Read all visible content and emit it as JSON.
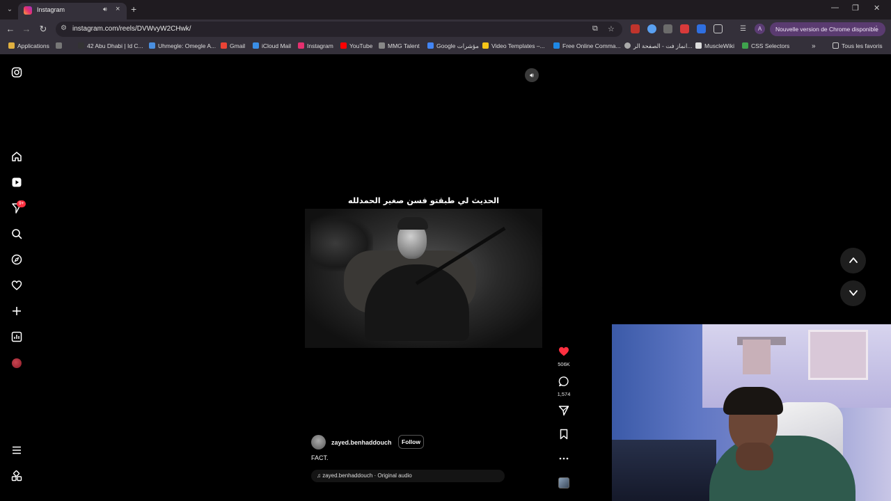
{
  "browser": {
    "tab_title": "Instagram",
    "url": "instagram.com/reels/DVWvyW2CHwk/",
    "update_label": "Nouvelle version de Chrome disponible",
    "avatar_letter": "A",
    "win_min": "—",
    "win_restore": "❐",
    "win_close": "✕",
    "bookmarks": [
      {
        "label": "Applications",
        "color": "#e0b040"
      },
      {
        "label": "42 Abu Dhabi | Id C...",
        "color": "#333333"
      },
      {
        "label": "Uhmegle: Omegle A...",
        "color": "#4a8fe0"
      },
      {
        "label": "Gmail",
        "color": "#ea4335"
      },
      {
        "label": "iCloud Mail",
        "color": "#3a8ee6"
      },
      {
        "label": "Instagram",
        "color": "#e5306f"
      },
      {
        "label": "YouTube",
        "color": "#ff0000"
      },
      {
        "label": "MMG Talent",
        "color": "#888888"
      },
      {
        "label": "Google مؤشرات",
        "color": "#4285f4"
      },
      {
        "label": "Video Templates –...",
        "color": "#f5c518"
      },
      {
        "label": "Free Online Comma...",
        "color": "#1e88e5"
      },
      {
        "label": "انماز فت - الصفحة الر...",
        "color": "#aaaaaa"
      },
      {
        "label": "MuscleWiki",
        "color": "#dddddd"
      },
      {
        "label": "CSS Selectors",
        "color": "#3fa34d"
      }
    ],
    "all_bookmarks": "Tous les favoris"
  },
  "instagram": {
    "notification_badge": "9+",
    "reel": {
      "overlay_text": "الحديث لي طبقتو فسن صغير الحمدلله",
      "username": "zayed.benhaddouch",
      "follow_label": "Follow",
      "caption": "FACT.",
      "audio": "♫ zayed.benhaddouch · Original audio",
      "likes": "506K",
      "comments": "1,574"
    },
    "colors": {
      "like": "#ff3040",
      "background": "#000000"
    }
  }
}
